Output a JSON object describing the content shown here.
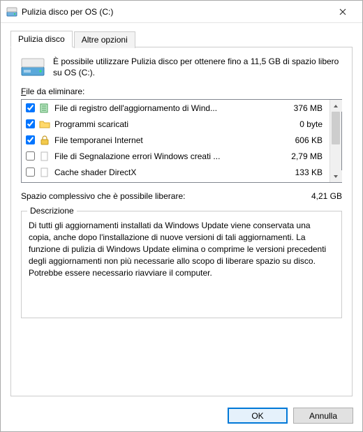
{
  "window": {
    "title": "Pulizia disco per OS (C:)"
  },
  "tabs": {
    "cleanup": "Pulizia disco",
    "more": "Altre opzioni"
  },
  "intro": "È possibile utilizzare Pulizia disco per ottenere fino a 11,5 GB di spazio libero su OS (C:).",
  "files_label_prefix": "F",
  "files_label_rest": "ile da eliminare:",
  "files": [
    {
      "checked": true,
      "icon": "log",
      "name": "File di registro dell'aggiornamento di Wind...",
      "size": "376 MB"
    },
    {
      "checked": true,
      "icon": "folder",
      "name": "Programmi scaricati",
      "size": "0 byte"
    },
    {
      "checked": true,
      "icon": "lock",
      "name": "File temporanei Internet",
      "size": "606 KB"
    },
    {
      "checked": false,
      "icon": "blank",
      "name": "File di Segnalazione errori Windows creati ...",
      "size": "2,79 MB"
    },
    {
      "checked": false,
      "icon": "blank",
      "name": "Cache shader DirectX",
      "size": "133 KB"
    }
  ],
  "totals": {
    "label": "Spazio complessivo che è possibile liberare:",
    "value": "4,21 GB"
  },
  "description": {
    "title": "Descrizione",
    "text": "Di tutti gli aggiornamenti installati da Windows Update viene conservata una copia, anche dopo l'installazione di nuove versioni di tali aggiornamenti. La funzione di pulizia di Windows Update elimina o comprime le versioni precedenti degli aggiornamenti non più necessarie allo scopo di liberare spazio su disco. Potrebbe essere necessario riavviare il computer."
  },
  "buttons": {
    "ok": "OK",
    "cancel": "Annulla"
  }
}
